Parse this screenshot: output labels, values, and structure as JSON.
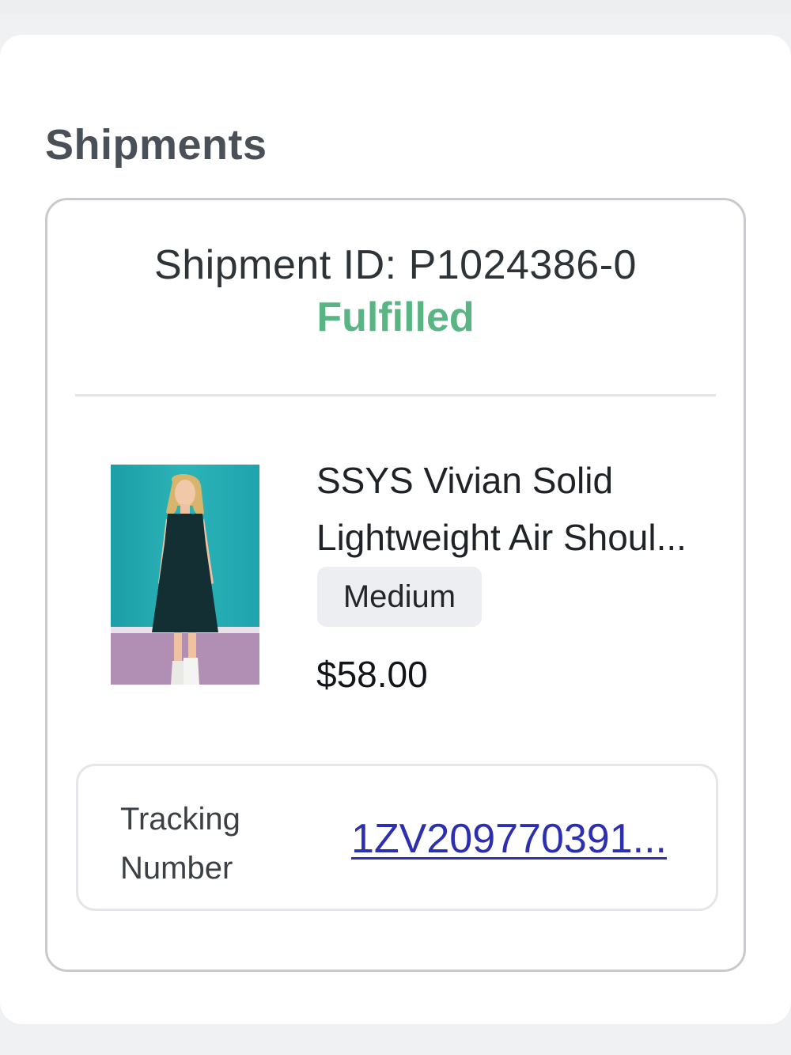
{
  "section": {
    "title": "Shipments"
  },
  "shipment": {
    "id_text": "Shipment ID: P1024386-0",
    "status": "Fulfilled",
    "status_color": "#5ab585",
    "item": {
      "name_line1": "SSYS Vivian Solid",
      "name_line2": "Lightweight Air Shoul...",
      "variant": "Medium",
      "price": "$58.00",
      "image_icon": "product-photo-dress"
    },
    "tracking": {
      "label": "Tracking Number",
      "number": "1ZV209770391...",
      "link_color": "#2c2fb0"
    }
  }
}
